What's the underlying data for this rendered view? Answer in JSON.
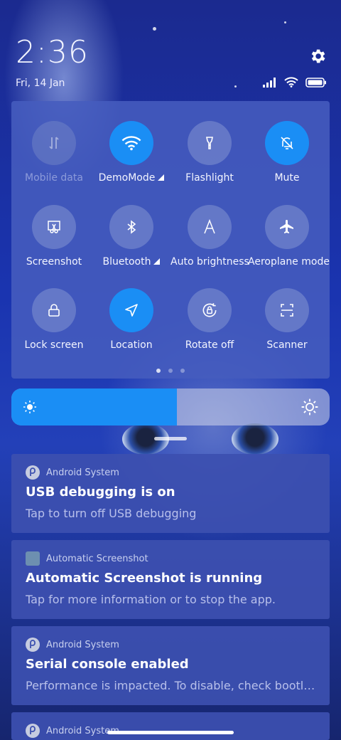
{
  "status_bar": {
    "time": "2:36",
    "date": "Fri, 14 Jan",
    "icons": [
      "signal-icon",
      "wifi-icon",
      "battery-icon"
    ],
    "settings_icon": "gear-icon"
  },
  "quick_settings": {
    "tiles": [
      {
        "label": "Mobile data",
        "icon": "mobile-data-icon",
        "state": "disabled"
      },
      {
        "label": "DemoMode",
        "icon": "wifi-icon",
        "state": "on",
        "has_expand": true
      },
      {
        "label": "Flashlight",
        "icon": "flashlight-icon",
        "state": "off"
      },
      {
        "label": "Mute",
        "icon": "bell-off-icon",
        "state": "on"
      },
      {
        "label": "Screenshot",
        "icon": "scissors-icon",
        "state": "off"
      },
      {
        "label": "Bluetooth",
        "icon": "bluetooth-icon",
        "state": "off",
        "has_expand": true
      },
      {
        "label": "Auto brightness",
        "icon": "auto-brightness-icon",
        "state": "off"
      },
      {
        "label": "Aeroplane mode",
        "icon": "airplane-icon",
        "state": "off"
      },
      {
        "label": "Lock screen",
        "icon": "lock-icon",
        "state": "off"
      },
      {
        "label": "Location",
        "icon": "location-icon",
        "state": "on"
      },
      {
        "label": "Rotate off",
        "icon": "rotate-lock-icon",
        "state": "off"
      },
      {
        "label": "Scanner",
        "icon": "scanner-icon",
        "state": "off"
      }
    ],
    "page_count": 3,
    "active_page": 0
  },
  "brightness": {
    "level": 0.52,
    "accent": "#1a8ef5"
  },
  "notifications": [
    {
      "app": "Android System",
      "icon": "android-system-icon",
      "title": "USB debugging is on",
      "body": "Tap to turn off USB debugging"
    },
    {
      "app": "Automatic Screenshot",
      "icon": "app-square-icon",
      "title": "Automatic Screenshot is running",
      "body": "Tap for more information or to stop the app."
    },
    {
      "app": "Android System",
      "icon": "android-system-icon",
      "title": "Serial console enabled",
      "body": "Performance is impacted. To disable, check bootl…"
    },
    {
      "app": "Android System",
      "icon": "android-system-icon",
      "title": "",
      "body": ""
    }
  ]
}
